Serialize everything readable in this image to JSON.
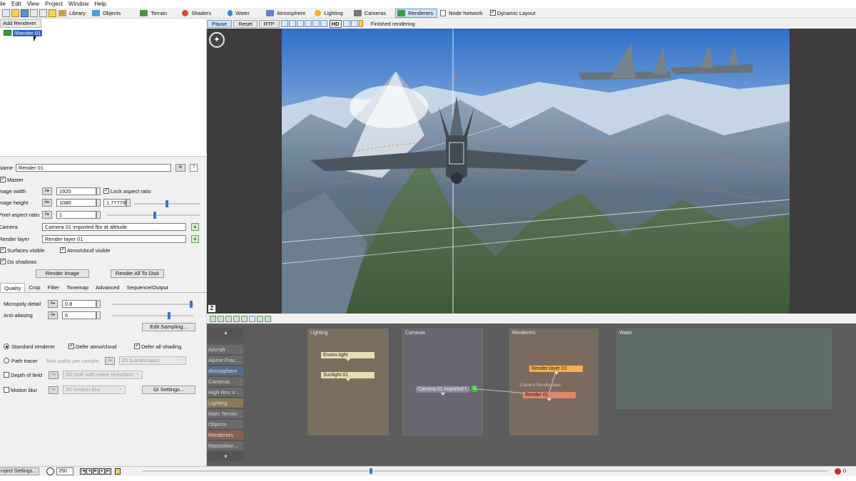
{
  "menu": [
    "ile",
    "Edit",
    "View",
    "Project",
    "Window",
    "Help"
  ],
  "toolbar": {
    "buttons": [
      {
        "label": "Library",
        "icon": "library-icon",
        "color": "#c7a14a"
      },
      {
        "label": "Objects",
        "icon": "cube-icon",
        "color": "#4e9bd6"
      },
      {
        "label": "Terrain",
        "icon": "terrain-icon",
        "color": "#4f8f3a"
      },
      {
        "label": "Shaders",
        "icon": "shader-sphere-icon",
        "color": "#d84a3a"
      },
      {
        "label": "Water",
        "icon": "water-drop-icon",
        "color": "#3b84d9"
      },
      {
        "label": "Atmosphere",
        "icon": "atmosphere-icon",
        "color": "#5a86c2"
      },
      {
        "label": "Lighting",
        "icon": "sun-icon",
        "color": "#f1b52a"
      },
      {
        "label": "Cameras",
        "icon": "camera-icon",
        "color": "#777777"
      },
      {
        "label": "Renderers",
        "icon": "renderer-icon",
        "color": "#3b9a48"
      },
      {
        "label": "Node Network",
        "icon": "node-network-icon",
        "color": "#666666"
      }
    ],
    "active": "Renderers",
    "dynamic_layout": {
      "label": "Dynamic Layout",
      "checked": true
    }
  },
  "renderer_tree": {
    "add_label": "Add Renderer",
    "item": "/Render 01"
  },
  "props": {
    "name_label": "Name",
    "name_value": "Render 01",
    "help": "?",
    "master_label": "Master",
    "image_width_label": "mage width",
    "image_width": "1920",
    "lock_aspect_label": "Lock aspect ratio",
    "image_height_label": "mage height",
    "image_height": "1080",
    "aspect_value": "1.77778",
    "pixel_aspect_label": "Pixel aspect ratio",
    "pixel_aspect": "1",
    "camera_label": "Camera",
    "camera_value": "Camera 01 imported fbx at altitude",
    "render_layer_label": "Render layer",
    "render_layer_value": "Render layer 01",
    "surfaces_visible": "Surfaces visible",
    "atmo_visible": "Atmo/cloud visible",
    "do_shadows": "Do shadows",
    "render_image": "Render Image",
    "render_all": "Render All To Disk",
    "tabs": [
      "Quality",
      "Crop",
      "Filter",
      "Tonemap",
      "Advanced",
      "Sequence/Output"
    ],
    "micropoly_label": "Micropoly detail",
    "micropoly": "0.8",
    "antialias_label": "Anti-aliasing",
    "antialias": "6",
    "edit_sampling": "Edit Sampling...",
    "standard_renderer": "Standard renderer",
    "defer_atmo": "Defer atmo/cloud",
    "defer_all": "Defer all shading",
    "path_tracer": "Path tracer",
    "max_paths": "Max paths per sample",
    "landscape": "25 (Landscape)",
    "dof_label": "Depth of field",
    "dof_value": "3D DoF with noise reduction",
    "motion_blur_label": "Motion blur",
    "motion_blur_value": "3D motion blur",
    "gi_settings": "GI Settings..."
  },
  "viewport_bar": {
    "pause": "Pause",
    "reset": "Reset",
    "rtp": "RTP",
    "hd": "HD",
    "status": "Finished rendering"
  },
  "node_network": {
    "sidebar": [
      "Aircraft",
      "Alpine Frac...",
      "Atmosphere",
      "Cameras",
      "High Res V...",
      "Lighting",
      "Main Terrain",
      "Objects",
      "Renderers",
      "Reposition..."
    ],
    "panels": {
      "lighting": "Lighting",
      "cameras": "Cameras",
      "renderers": "Renderers",
      "water": "Water"
    },
    "nodes": {
      "enviro": "Enviro light",
      "sunlight": "Sunlight 01",
      "camera": "Camera 01 imported f...",
      "render_layer": "Render layer 01",
      "render": "Render 01",
      "camera_port_label": "Camera",
      "render_layer_port_label": "Render layer"
    }
  },
  "bottom": {
    "project_settings": "roject Settings...",
    "frame": "250",
    "rec_count": "0"
  }
}
